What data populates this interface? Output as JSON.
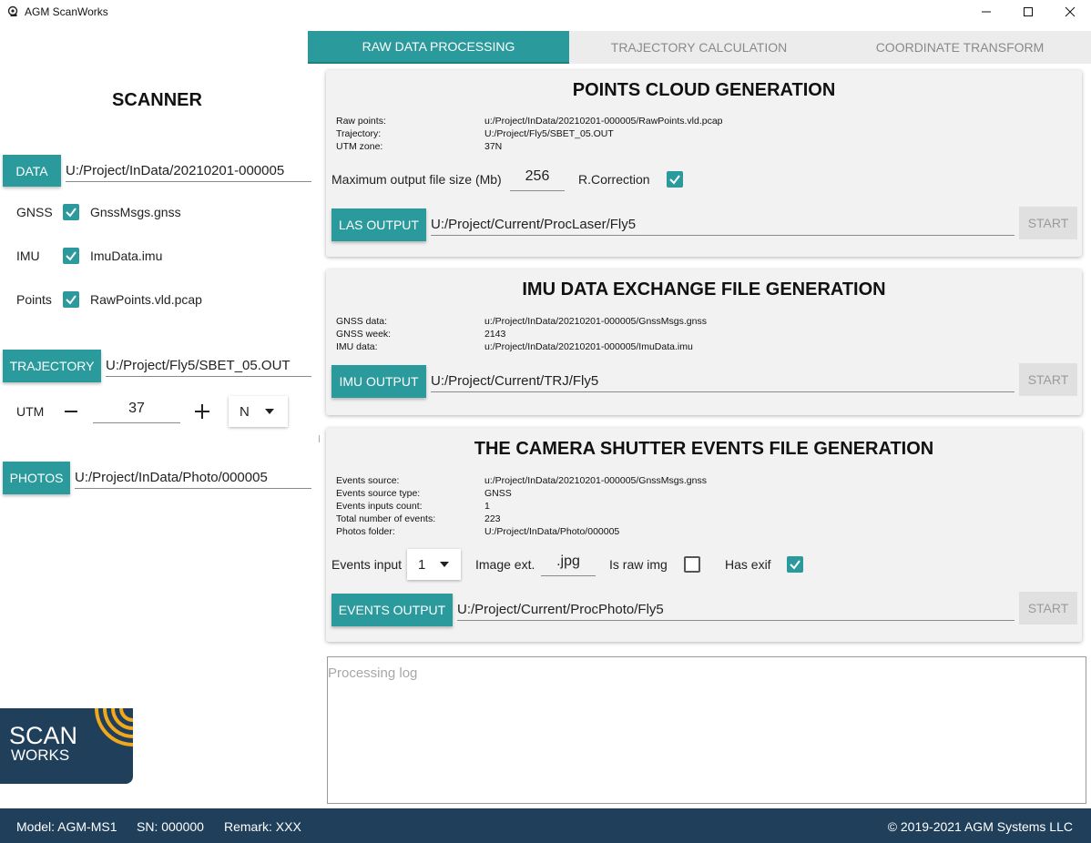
{
  "window": {
    "title": "AGM ScanWorks"
  },
  "tabs": [
    {
      "label": "RAW DATA PROCESSING",
      "active": true
    },
    {
      "label": "TRAJECTORY CALCULATION",
      "active": false
    },
    {
      "label": "COORDINATE TRANSFORM",
      "active": false
    }
  ],
  "sidebar": {
    "title": "SCANNER",
    "data_button": "DATA",
    "data_path": "U:/Project/InData/20210201-000005",
    "gnss_label": "GNSS",
    "gnss_file": "GnssMsgs.gnss",
    "imu_label": "IMU",
    "imu_file": "ImuData.imu",
    "points_label": "Points",
    "points_file": "RawPoints.vld.pcap",
    "trajectory_button": "TRAJECTORY",
    "trajectory_path": "U:/Project/Fly5/SBET_05.OUT",
    "utm_label": "UTM",
    "utm_value": "37",
    "utm_hemisphere": "N",
    "photos_button": "PHOTOS",
    "photos_path": "U:/Project/InData/Photo/000005",
    "logo_line1": "SCAN",
    "logo_line2": "WORKS"
  },
  "points_cloud": {
    "title": "POINTS CLOUD GENERATION",
    "info": [
      {
        "k": "Raw points:",
        "v": "u:/Project/InData/20210201-000005/RawPoints.vld.pcap"
      },
      {
        "k": "Trajectory:",
        "v": "U:/Project/Fly5/SBET_05.OUT"
      },
      {
        "k": "UTM zone:",
        "v": "37N"
      }
    ],
    "max_size_label": "Maximum output file size (Mb)",
    "max_size_value": "256",
    "rcorrection_label": "R.Correction",
    "output_button": "LAS OUTPUT",
    "output_path": "U:/Project/Current/ProcLaser/Fly5",
    "start_button": "START"
  },
  "imu_exchange": {
    "title": "IMU DATA EXCHANGE FILE GENERATION",
    "info": [
      {
        "k": "GNSS data:",
        "v": "u:/Project/InData/20210201-000005/GnssMsgs.gnss"
      },
      {
        "k": "GNSS week:",
        "v": "2143"
      },
      {
        "k": "IMU data:",
        "v": "u:/Project/InData/20210201-000005/ImuData.imu"
      }
    ],
    "output_button": "IMU OUTPUT",
    "output_path": "U:/Project/Current/TRJ/Fly5",
    "start_button": "START"
  },
  "camera_events": {
    "title": "THE CAMERA SHUTTER EVENTS FILE GENERATION",
    "info": [
      {
        "k": "Events source:",
        "v": "u:/Project/InData/20210201-000005/GnssMsgs.gnss"
      },
      {
        "k": "Events source type:",
        "v": "GNSS"
      },
      {
        "k": "Events inputs count:",
        "v": "1"
      },
      {
        "k": "Total number of events:",
        "v": "223"
      },
      {
        "k": "Photos folder:",
        "v": "U:/Project/InData/Photo/000005"
      }
    ],
    "events_input_label": "Events input",
    "events_input_value": "1",
    "image_ext_label": "Image ext.",
    "image_ext_value": ".jpg",
    "is_raw_label": "Is raw img",
    "has_exif_label": "Has exif",
    "output_button": "EVENTS OUTPUT",
    "output_path": "U:/Project/Current/ProcPhoto/Fly5",
    "start_button": "START"
  },
  "log": {
    "placeholder": "Processing log"
  },
  "footer": {
    "model": "Model: AGM-MS1",
    "sn": "SN: 000000",
    "remark": "Remark: XXX",
    "copyright": "© 2019-2021 AGM Systems LLC"
  },
  "colors": {
    "accent": "#2a9a9c",
    "footer": "#1f3f5b",
    "logo_orange": "#f2a81d"
  }
}
